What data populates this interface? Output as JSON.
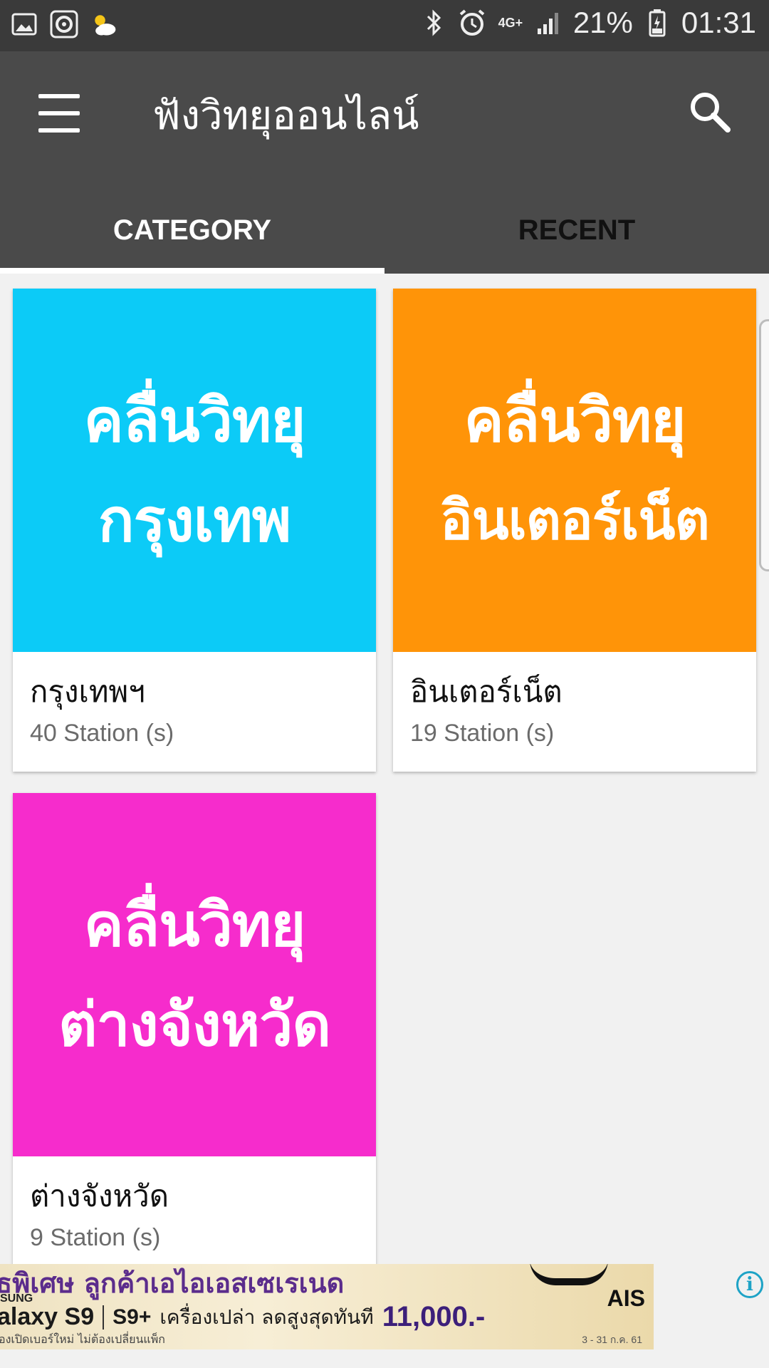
{
  "status_bar": {
    "left_icons": [
      "image-icon",
      "record-icon",
      "weather-icon"
    ],
    "right_icons": [
      "bluetooth-icon",
      "alarm-icon",
      "network-4g-icon",
      "signal-icon",
      "battery-icon"
    ],
    "network": "4G+",
    "battery": "21%",
    "time": "01:31"
  },
  "app_bar": {
    "title": "ฟังวิทยุออนไลน์",
    "menu_icon": "hamburger-icon",
    "search_icon": "search-icon"
  },
  "tabs": [
    {
      "label": "CATEGORY",
      "active": true
    },
    {
      "label": "RECENT",
      "active": false
    }
  ],
  "categories": [
    {
      "image_line1": "คลื่นวิทยุ",
      "image_line2": "กรุงเทพ",
      "color": "#0ccbf7",
      "title": "กรุงเทพฯ",
      "count": "40 Station (s)"
    },
    {
      "image_line1": "คลื่นวิทยุ",
      "image_line2": "อินเตอร์เน็ต",
      "color": "#ff9408",
      "title": "อินเตอร์เน็ต",
      "count": "19 Station (s)"
    },
    {
      "image_line1": "คลื่นวิทยุ",
      "image_line2": "ต่างจังหวัด",
      "color": "#f62ccc",
      "title": "ต่างจังหวัด",
      "count": "9 Station (s)"
    }
  ],
  "ad": {
    "line1": "ธพิเศษ ลูกค้าเอไอเอสเซเรเนด",
    "brand": "SUNG",
    "model1": "alaxy S9",
    "model2": "S9+",
    "offer": "เครื่องเปล่า ลดสูงสุดทันที",
    "price": "11,000.-",
    "line3": "องเปิดเบอร์ใหม่ ไม่ต้องเปลี่ยนแพ็ก",
    "date": "3 - 31 ก.ค. 61",
    "logo": "AIS",
    "info_icon": "info-icon",
    "info_glyph": "i"
  }
}
